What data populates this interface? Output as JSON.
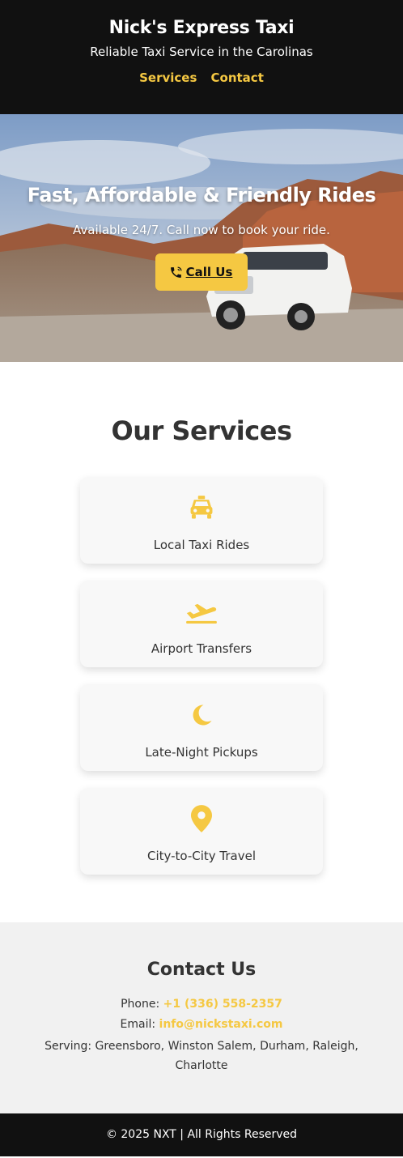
{
  "header": {
    "title": "Nick's Express Taxi",
    "tagline": "Reliable Taxi Service in the Carolinas",
    "nav": [
      "Services",
      "Contact"
    ]
  },
  "hero": {
    "title": "Fast, Affordable & Friendly Rides",
    "subtitle": "Available 24/7. Call now to book your ride.",
    "cta_label": "Call Us",
    "cta_icon": "phone-icon"
  },
  "services": {
    "heading": "Our Services",
    "items": [
      {
        "label": "Local Taxi Rides",
        "icon": "taxi-icon"
      },
      {
        "label": "Airport Transfers",
        "icon": "plane-departure-icon"
      },
      {
        "label": "Late-Night Pickups",
        "icon": "moon-icon"
      },
      {
        "label": "City-to-City Travel",
        "icon": "map-pin-icon"
      }
    ]
  },
  "contact": {
    "heading": "Contact Us",
    "phone_label": "Phone:",
    "phone": "+1 (336) 558-2357",
    "email_label": "Email:",
    "email": "info@nickstaxi.com",
    "serving": "Serving: Greensboro, Winston Salem, Durham, Raleigh, Charlotte"
  },
  "footer": {
    "text": "© 2025 NXT | All Rights Reserved"
  },
  "colors": {
    "accent": "#f5c842",
    "dark": "#111111",
    "card_bg": "#f8f8f8",
    "contact_bg": "#f1f1f1"
  }
}
